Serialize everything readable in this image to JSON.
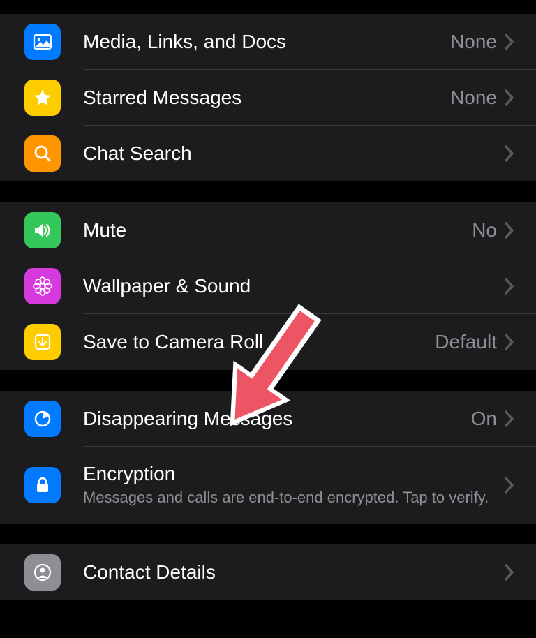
{
  "sections": [
    {
      "rows": [
        {
          "id": "media",
          "icon": "media-icon",
          "icon_bg": "#007aff",
          "label": "Media, Links, and Docs",
          "value": "None"
        },
        {
          "id": "starred",
          "icon": "star-icon",
          "icon_bg": "#ffcc00",
          "label": "Starred Messages",
          "value": "None"
        },
        {
          "id": "search",
          "icon": "search-icon",
          "icon_bg": "#ff9500",
          "label": "Chat Search",
          "value": ""
        }
      ]
    },
    {
      "rows": [
        {
          "id": "mute",
          "icon": "speaker-icon",
          "icon_bg": "#34c759",
          "label": "Mute",
          "value": "No"
        },
        {
          "id": "wallpaper",
          "icon": "flower-icon",
          "icon_bg": "#d63adf",
          "label": "Wallpaper & Sound",
          "value": ""
        },
        {
          "id": "saveroll",
          "icon": "download-icon",
          "icon_bg": "#ffcc00",
          "label": "Save to Camera Roll",
          "value": "Default"
        }
      ]
    },
    {
      "rows": [
        {
          "id": "disappearing",
          "icon": "timer-icon",
          "icon_bg": "#007aff",
          "label": "Disappearing Messages",
          "value": "On"
        },
        {
          "id": "encryption",
          "icon": "lock-icon",
          "icon_bg": "#007aff",
          "label": "Encryption",
          "sublabel": "Messages and calls are end-to-end encrypted. Tap to verify.",
          "value": ""
        }
      ]
    },
    {
      "rows": [
        {
          "id": "contact",
          "icon": "contact-icon",
          "icon_bg": "#8e8e93",
          "label": "Contact Details",
          "value": ""
        }
      ]
    }
  ],
  "annotation": {
    "type": "arrow",
    "target": "disappearing"
  }
}
